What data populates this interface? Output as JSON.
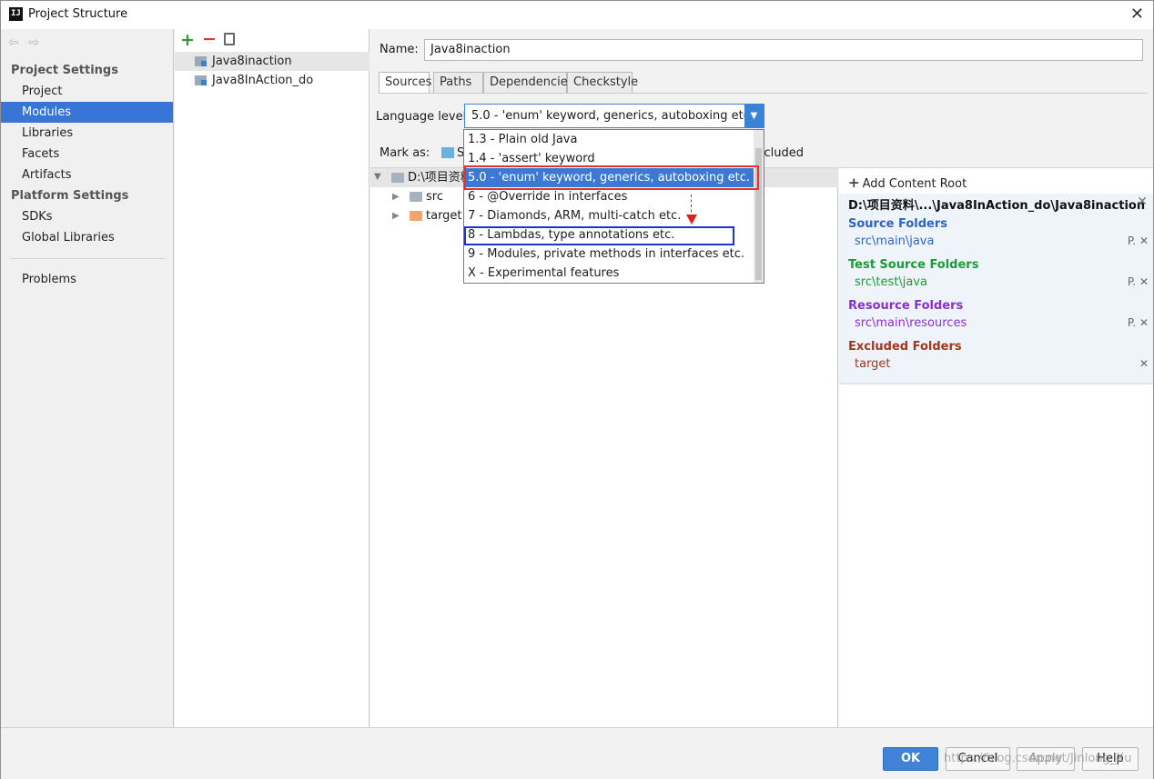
{
  "window": {
    "title": "Project Structure",
    "close": "✕",
    "app_icon": "IJ"
  },
  "nav": {
    "back": "⇦",
    "forward": "⇨"
  },
  "sidebar": {
    "project_settings_title": "Project Settings",
    "project_items": [
      "Project",
      "Modules",
      "Libraries",
      "Facets",
      "Artifacts"
    ],
    "platform_settings_title": "Platform Settings",
    "platform_items": [
      "SDKs",
      "Global Libraries"
    ],
    "problems": "Problems",
    "selected": "Modules"
  },
  "modules": {
    "toolbar": {
      "add": "+",
      "remove": "−"
    },
    "items": [
      "Java8inaction",
      "Java8InAction_do"
    ],
    "selected": "Java8inaction"
  },
  "main": {
    "name_label": "Name:",
    "name_value": "Java8inaction",
    "tabs": [
      "Sources",
      "Paths",
      "Dependencies",
      "Checkstyle"
    ],
    "active_tab": "Sources",
    "language_label": "Language level:",
    "language_value": "5.0 - 'enum' keyword, generics, autoboxing etc.",
    "mark_as_label": "Mark as:",
    "mark_as_partial": "S",
    "excluded_partial": "xcluded"
  },
  "tree": {
    "root": "D:\\项目资料",
    "children": [
      "src",
      "target"
    ]
  },
  "dropdown": {
    "options": [
      "1.3 - Plain old Java",
      "1.4 - 'assert' keyword",
      "5.0 - 'enum' keyword, generics, autoboxing etc.",
      "6 - @Override in interfaces",
      "7 - Diamonds, ARM, multi-catch etc.",
      "8 - Lambdas, type annotations etc.",
      "9 - Modules, private methods in interfaces etc.",
      "X - Experimental features"
    ],
    "selected_index": 2,
    "target_index": 5
  },
  "content_roots": {
    "add_label": "Add Content Root",
    "root_path": "D:\\项目资料\\...\\Java8InAction_do\\Java8inaction",
    "source_title": "Source Folders",
    "source_path": "src\\main\\java",
    "test_title": "Test Source Folders",
    "test_path": "src\\test\\java",
    "resource_title": "Resource Folders",
    "resource_path": "src\\main\\resources",
    "excluded_title": "Excluded Folders",
    "excluded_path": "target",
    "action_props": "P.",
    "action_remove": "✕"
  },
  "buttons": {
    "ok": "OK",
    "cancel": "Cancel",
    "apply": "Apply",
    "help": "Help"
  },
  "watermark": "https://blog.csdn.net/Jinlong_Xu",
  "colors": {
    "selection": "#3875d7",
    "source": "#2f64c2",
    "test": "#1d9a37",
    "resource": "#8a2fd0",
    "excluded": "#a2361f",
    "highlight_red": "#e23131",
    "highlight_blue": "#1e33d6"
  }
}
